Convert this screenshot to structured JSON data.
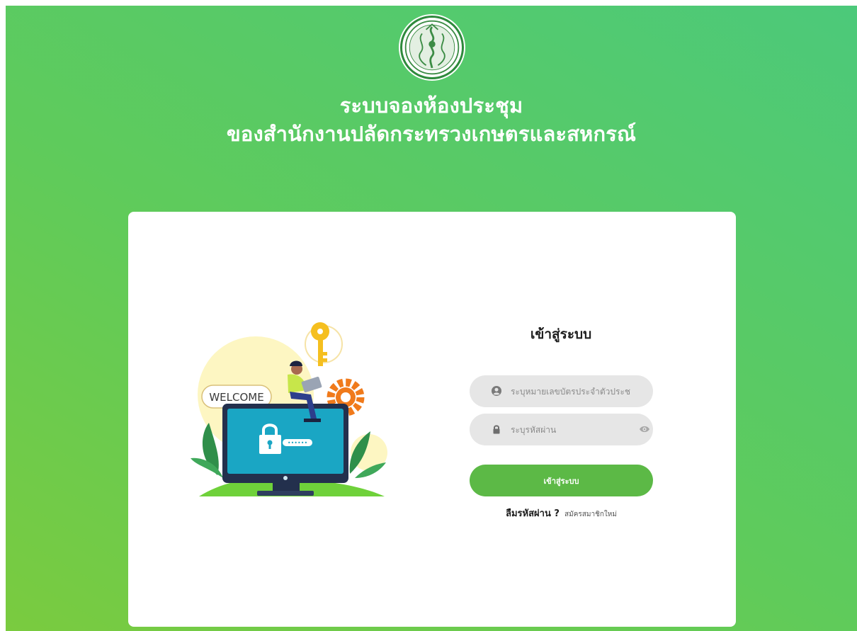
{
  "header": {
    "title_line1": "ระบบจองห้องประชุม",
    "title_line2": "ของสำนักงานปลัดกระทรวงเกษตรและสหกรณ์"
  },
  "login": {
    "heading": "เข้าสู่ระบบ",
    "id_placeholder": "ระบุหมายเลขบัตรประจำตัวประชาชน",
    "password_placeholder": "ระบุรหัสผ่าน",
    "submit_label": "เข้าสู่ระบบ",
    "forgot_label": "ลืมรหัสผ่าน ?",
    "register_label": "สมัครสมาชิกใหม่"
  },
  "illustration": {
    "welcome_text": "WELCOME"
  },
  "icons": {
    "user": "user-circle-icon",
    "lock": "lock-icon",
    "eye": "eye-icon",
    "seal": "ministry-seal-logo"
  },
  "colors": {
    "background_start": "#7acb3f",
    "background_end": "#4cc97a",
    "button": "#5cb946",
    "field": "#e6e6e6"
  }
}
